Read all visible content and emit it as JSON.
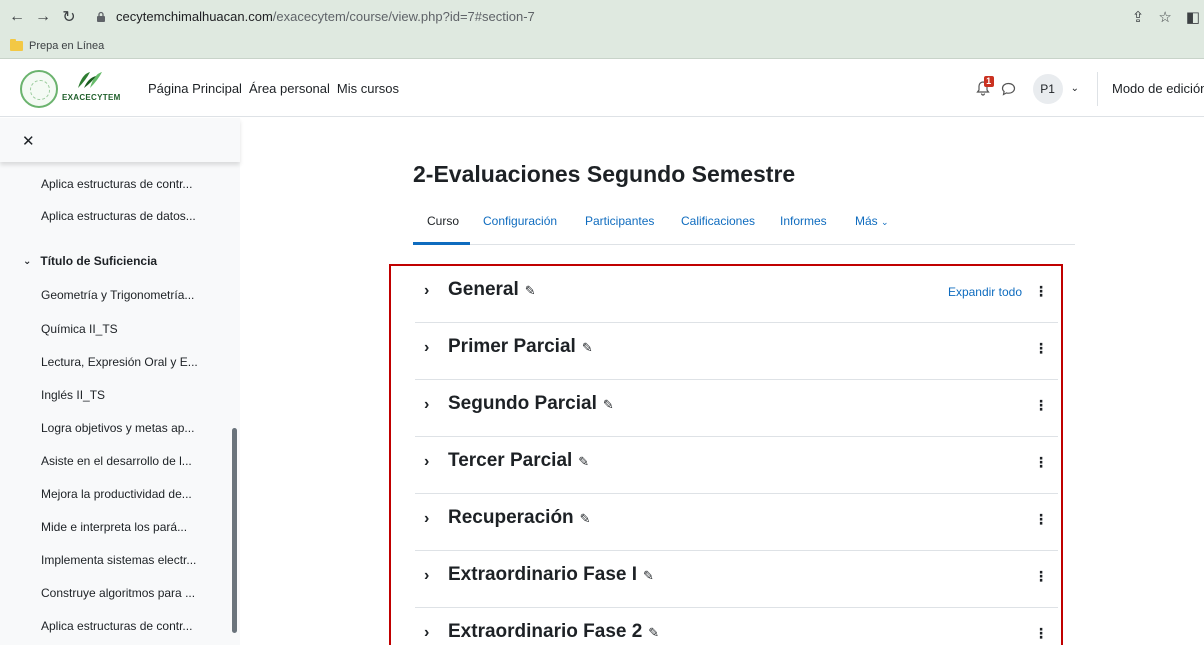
{
  "browser": {
    "url_host": "cecytemchimalhuacan.com",
    "url_path": "/exacecytem/course/view.php?id=7#section-7",
    "bookmark_folder": "Prepa en Línea"
  },
  "navbar": {
    "logo_text": "EXACECYTEM",
    "links": [
      "Página Principal",
      "Área personal",
      "Mis cursos"
    ],
    "notification_count": "1",
    "avatar_initials": "P1",
    "edit_mode_label": "Modo de edición"
  },
  "drawer": {
    "items_top": [
      "Aplica estructuras de contr...",
      "Aplica estructuras de datos..."
    ],
    "section_title": "Título de Suficiencia",
    "items": [
      "Geometría y Trigonometría...",
      "Química II_TS",
      "Lectura, Expresión Oral y E...",
      "Inglés II_TS",
      "Logra objetivos y metas ap...",
      "Asiste en el desarrollo de l...",
      "Mejora la productividad de...",
      "Mide e interpreta los pará...",
      "Implementa sistemas electr...",
      "Construye algoritmos para ...",
      "Aplica estructuras de contr..."
    ]
  },
  "course": {
    "title": "2-Evaluaciones Segundo Semestre",
    "tabs": [
      "Curso",
      "Configuración",
      "Participantes",
      "Calificaciones",
      "Informes",
      "Más"
    ],
    "expand_all": "Expandir todo",
    "sections": [
      "General",
      "Primer Parcial",
      "Segundo Parcial",
      "Tercer Parcial",
      "Recuperación",
      "Extraordinario Fase I",
      "Extraordinario Fase 2"
    ]
  },
  "colors": {
    "link": "#0f6cbf",
    "highlight_border": "#c00000",
    "chrome": "#dfe9e0"
  }
}
